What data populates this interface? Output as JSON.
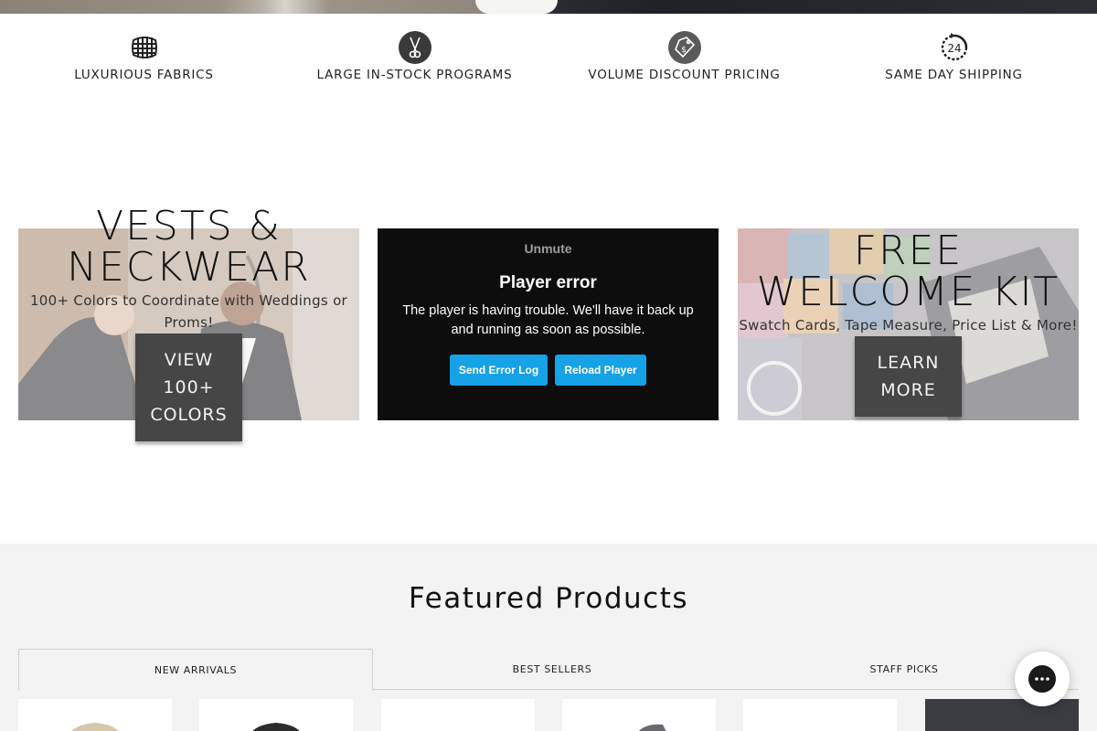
{
  "features": [
    {
      "icon": "fabric-grid-icon",
      "label": "LUXURIOUS FABRICS"
    },
    {
      "icon": "scissors-icon",
      "label": "LARGE IN-STOCK PROGRAMS"
    },
    {
      "icon": "price-tag-icon",
      "label": "VOLUME DISCOUNT PRICING"
    },
    {
      "icon": "24-hour-icon",
      "label": "SAME DAY SHIPPING"
    }
  ],
  "promo_vests": {
    "title_line1": "VESTS &",
    "title_line2": "NECKWEAR",
    "subtitle_line1": "100+ Colors to Coordinate with Weddings or",
    "subtitle_line2": "Proms!",
    "button_line1": "VIEW",
    "button_line2": "100+",
    "button_line3": "COLORS"
  },
  "video_player": {
    "unmute": "Unmute",
    "error_title": "Player error",
    "error_message": "The player is having trouble. We'll have it back up and running as soon as possible.",
    "send_log": "Send Error Log",
    "reload": "Reload Player"
  },
  "promo_kit": {
    "title_line1": "FREE",
    "title_line2": "WELCOME KIT",
    "subtitle": "Swatch Cards, Tape Measure, Price List & More!",
    "button_line1": "LEARN",
    "button_line2": "MORE"
  },
  "featured": {
    "heading": "Featured Products",
    "tabs": [
      "NEW ARRIVALS",
      "BEST SELLERS",
      "STAFF PICKS"
    ],
    "active_tab": "NEW ARRIVALS"
  },
  "colors": {
    "button_dark": "#464646",
    "player_button": "#16a2e6",
    "section_bg": "#f3f3f3"
  }
}
